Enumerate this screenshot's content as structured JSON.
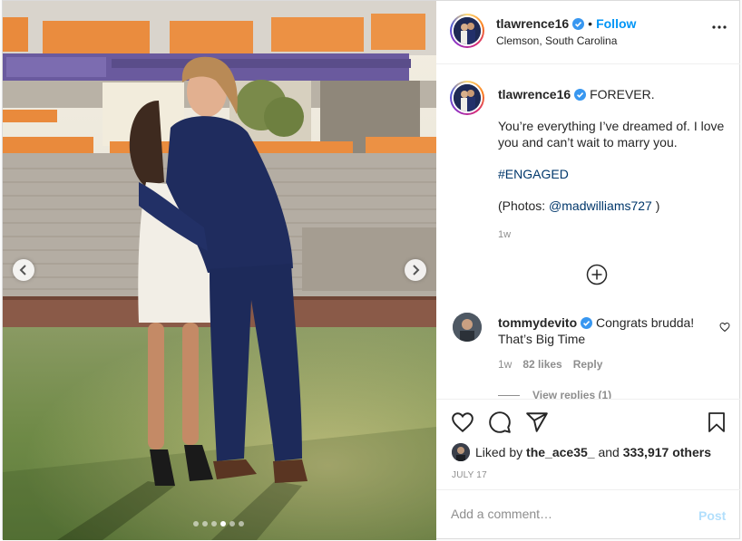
{
  "header": {
    "username": "tlawrence16",
    "separator": "•",
    "follow_label": "Follow",
    "location": "Clemson, South Carolina"
  },
  "caption": {
    "username": "tlawrence16",
    "line1": "FOREVER.",
    "line2": "You’re everything I’ve dreamed of. I love you and can’t wait to marry you.",
    "hashtag": "#ENGAGED",
    "photos_prefix": "(Photos: ",
    "photos_mention": "@madwilliams727",
    "photos_suffix": " )",
    "time": "1w"
  },
  "comment": {
    "username": "tommydevito",
    "text": "Congrats brudda! That’s Big Time",
    "time": "1w",
    "likes": "82 likes",
    "reply_label": "Reply",
    "view_replies": "View replies (1)"
  },
  "likes": {
    "prefix": "Liked by",
    "user": "the_ace35_",
    "middle": "and",
    "count": "333,917 others"
  },
  "date": "JULY 17",
  "add_comment": {
    "placeholder": "Add a comment…",
    "post_label": "Post"
  },
  "carousel": {
    "slides": 6,
    "active_index": 3
  },
  "icons": {
    "verified": "verified-badge-icon",
    "more": "more-options-icon",
    "load_more": "load-more-comments-icon",
    "like": "heart-icon",
    "comment": "comment-icon",
    "share": "share-icon",
    "save": "bookmark-icon",
    "prev": "chevron-left-icon",
    "next": "chevron-right-icon"
  },
  "colors": {
    "accent": "#0095f6",
    "text": "#262626",
    "muted": "#8e8e8e",
    "link": "#00376b",
    "post_disabled": "#b2dffc"
  }
}
